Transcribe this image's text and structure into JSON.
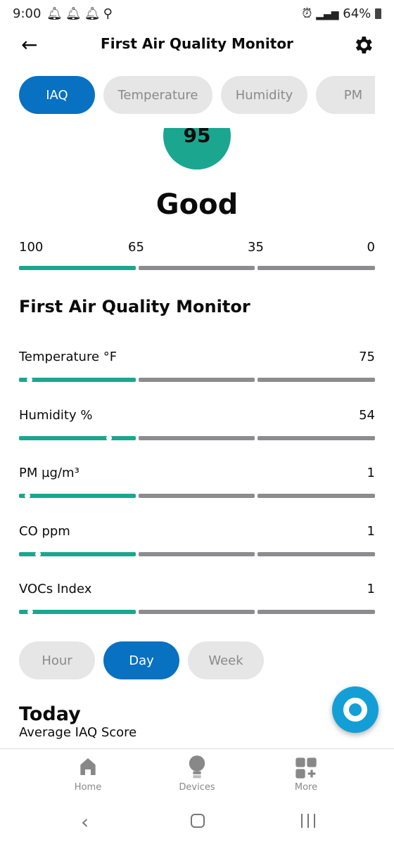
{
  "status_bar": {
    "time": "9:00",
    "left_icons": [
      "bell-icon",
      "bell-icon",
      "bell-icon",
      "location-icon"
    ],
    "right_icons": [
      "alarm-icon",
      "location-icon",
      "wifi-icon",
      "signal-icon"
    ],
    "battery": "64%"
  },
  "header": {
    "title": "First Air Quality Monitor",
    "back_icon": "arrow-left-icon",
    "settings_icon": "gear-icon"
  },
  "tabs": [
    {
      "label": "IAQ",
      "active": true
    },
    {
      "label": "Temperature"
    },
    {
      "label": "Humidity"
    },
    {
      "label": "PM"
    }
  ],
  "score": {
    "value": "95",
    "rating": "Good",
    "color": "#1aa68f",
    "scale_labels": [
      "100",
      "65",
      "35",
      "0"
    ]
  },
  "section_title": "First Air Quality Monitor",
  "metrics": [
    {
      "label": "Temperature °F",
      "value": "75",
      "indicator_fraction": 0.016
    },
    {
      "label": "Humidity %",
      "value": "54",
      "indicator_fraction": 0.24
    },
    {
      "label": "PM µg/m³",
      "value": "1",
      "indicator_fraction": 0.01
    },
    {
      "label": "CO ppm",
      "value": "1",
      "indicator_fraction": 0.04
    },
    {
      "label": "VOCs Index",
      "value": "1",
      "indicator_fraction": 0.018
    }
  ],
  "range_buttons": [
    {
      "label": "Hour"
    },
    {
      "label": "Day",
      "active": true
    },
    {
      "label": "Week"
    }
  ],
  "summary": {
    "title": "Today",
    "subtitle": "Average IAQ Score"
  },
  "bottom_nav": [
    {
      "label": "Home",
      "icon": "home-icon"
    },
    {
      "label": "Devices",
      "icon": "bulb-icon"
    },
    {
      "label": "More",
      "icon": "grid-plus-icon"
    }
  ],
  "colors": {
    "accent": "#0871c2",
    "good": "#1aa68f",
    "alexa": "#139fd6"
  }
}
